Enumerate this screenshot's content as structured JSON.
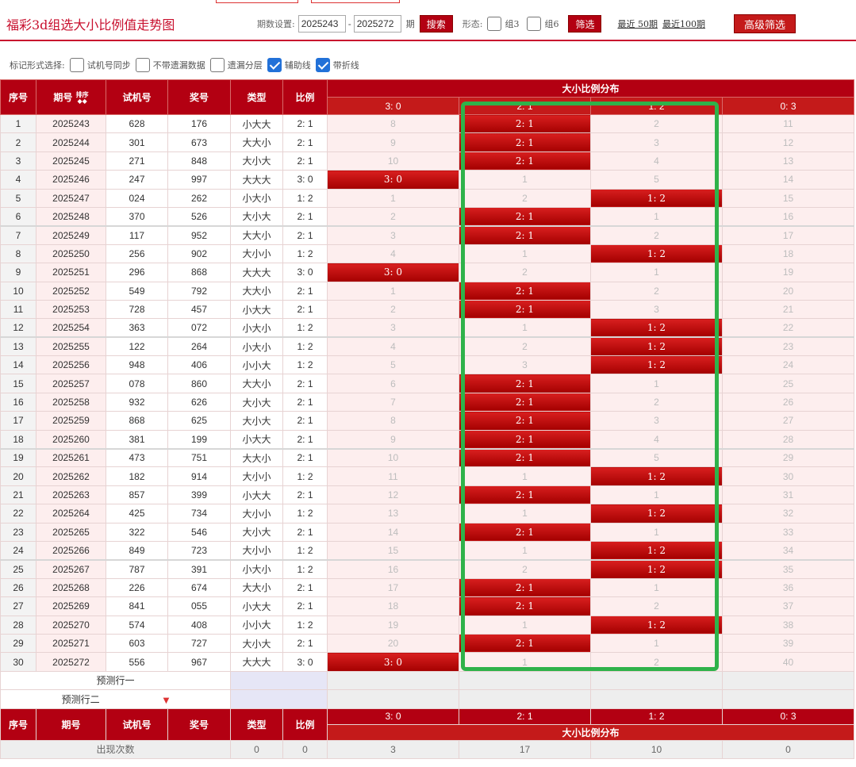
{
  "header": {
    "title": "福彩3d组选大小比例值走势图",
    "issue_label": "期数设置:",
    "issue_from": "2025243",
    "issue_to": "2025272",
    "issue_suffix": "期",
    "search_button": "搜索",
    "form_label": "形态:",
    "group3_label": "组3",
    "group6_label": "组6",
    "filter_button": "筛选",
    "recent50": "最近 50期",
    "recent100": "最近100期",
    "advanced_button": "高级筛选"
  },
  "markbar": {
    "label": "标记形式选择:",
    "opt1": "试机号同步",
    "opt2": "不带遗漏数据",
    "opt3": "遗漏分层",
    "opt4": "辅助线",
    "opt5": "带折线",
    "opt4_checked": true,
    "opt5_checked": true
  },
  "table": {
    "headers": {
      "seq": "序号",
      "issue": "期号",
      "sort": "排序",
      "trial": "试机号",
      "prize": "奖号",
      "type": "类型",
      "ratio": "比例",
      "distribution": "大小比例分布"
    },
    "dist_columns": [
      "3: 0",
      "2: 1",
      "1: 2",
      "0: 3"
    ],
    "rows": [
      {
        "seq": "1",
        "issue": "2025243",
        "trial": "628",
        "prize": "176",
        "type": "小大大",
        "ratio": "2: 1",
        "dist": [
          "8",
          "2: 1",
          "2",
          "11"
        ],
        "hit": 1
      },
      {
        "seq": "2",
        "issue": "2025244",
        "trial": "301",
        "prize": "673",
        "type": "大大小",
        "ratio": "2: 1",
        "dist": [
          "9",
          "2: 1",
          "3",
          "12"
        ],
        "hit": 1
      },
      {
        "seq": "3",
        "issue": "2025245",
        "trial": "271",
        "prize": "848",
        "type": "大小大",
        "ratio": "2: 1",
        "dist": [
          "10",
          "2: 1",
          "4",
          "13"
        ],
        "hit": 1
      },
      {
        "seq": "4",
        "issue": "2025246",
        "trial": "247",
        "prize": "997",
        "type": "大大大",
        "ratio": "3: 0",
        "dist": [
          "3: 0",
          "1",
          "5",
          "14"
        ],
        "hit": 0
      },
      {
        "seq": "5",
        "issue": "2025247",
        "trial": "024",
        "prize": "262",
        "type": "小大小",
        "ratio": "1: 2",
        "dist": [
          "1",
          "2",
          "1: 2",
          "15"
        ],
        "hit": 2
      },
      {
        "seq": "6",
        "issue": "2025248",
        "trial": "370",
        "prize": "526",
        "type": "大小大",
        "ratio": "2: 1",
        "dist": [
          "2",
          "2: 1",
          "1",
          "16"
        ],
        "hit": 1
      },
      {
        "seq": "7",
        "issue": "2025249",
        "trial": "117",
        "prize": "952",
        "type": "大大小",
        "ratio": "2: 1",
        "dist": [
          "3",
          "2: 1",
          "2",
          "17"
        ],
        "hit": 1
      },
      {
        "seq": "8",
        "issue": "2025250",
        "trial": "256",
        "prize": "902",
        "type": "大小小",
        "ratio": "1: 2",
        "dist": [
          "4",
          "1",
          "1: 2",
          "18"
        ],
        "hit": 2
      },
      {
        "seq": "9",
        "issue": "2025251",
        "trial": "296",
        "prize": "868",
        "type": "大大大",
        "ratio": "3: 0",
        "dist": [
          "3: 0",
          "2",
          "1",
          "19"
        ],
        "hit": 0
      },
      {
        "seq": "10",
        "issue": "2025252",
        "trial": "549",
        "prize": "792",
        "type": "大大小",
        "ratio": "2: 1",
        "dist": [
          "1",
          "2: 1",
          "2",
          "20"
        ],
        "hit": 1
      },
      {
        "seq": "11",
        "issue": "2025253",
        "trial": "728",
        "prize": "457",
        "type": "小大大",
        "ratio": "2: 1",
        "dist": [
          "2",
          "2: 1",
          "3",
          "21"
        ],
        "hit": 1
      },
      {
        "seq": "12",
        "issue": "2025254",
        "trial": "363",
        "prize": "072",
        "type": "小大小",
        "ratio": "1: 2",
        "dist": [
          "3",
          "1",
          "1: 2",
          "22"
        ],
        "hit": 2
      },
      {
        "seq": "13",
        "issue": "2025255",
        "trial": "122",
        "prize": "264",
        "type": "小大小",
        "ratio": "1: 2",
        "dist": [
          "4",
          "2",
          "1: 2",
          "23"
        ],
        "hit": 2
      },
      {
        "seq": "14",
        "issue": "2025256",
        "trial": "948",
        "prize": "406",
        "type": "小小大",
        "ratio": "1: 2",
        "dist": [
          "5",
          "3",
          "1: 2",
          "24"
        ],
        "hit": 2
      },
      {
        "seq": "15",
        "issue": "2025257",
        "trial": "078",
        "prize": "860",
        "type": "大大小",
        "ratio": "2: 1",
        "dist": [
          "6",
          "2: 1",
          "1",
          "25"
        ],
        "hit": 1
      },
      {
        "seq": "16",
        "issue": "2025258",
        "trial": "932",
        "prize": "626",
        "type": "大小大",
        "ratio": "2: 1",
        "dist": [
          "7",
          "2: 1",
          "2",
          "26"
        ],
        "hit": 1
      },
      {
        "seq": "17",
        "issue": "2025259",
        "trial": "868",
        "prize": "625",
        "type": "大小大",
        "ratio": "2: 1",
        "dist": [
          "8",
          "2: 1",
          "3",
          "27"
        ],
        "hit": 1
      },
      {
        "seq": "18",
        "issue": "2025260",
        "trial": "381",
        "prize": "199",
        "type": "小大大",
        "ratio": "2: 1",
        "dist": [
          "9",
          "2: 1",
          "4",
          "28"
        ],
        "hit": 1
      },
      {
        "seq": "19",
        "issue": "2025261",
        "trial": "473",
        "prize": "751",
        "type": "大大小",
        "ratio": "2: 1",
        "dist": [
          "10",
          "2: 1",
          "5",
          "29"
        ],
        "hit": 1
      },
      {
        "seq": "20",
        "issue": "2025262",
        "trial": "182",
        "prize": "914",
        "type": "大小小",
        "ratio": "1: 2",
        "dist": [
          "11",
          "1",
          "1: 2",
          "30"
        ],
        "hit": 2
      },
      {
        "seq": "21",
        "issue": "2025263",
        "trial": "857",
        "prize": "399",
        "type": "小大大",
        "ratio": "2: 1",
        "dist": [
          "12",
          "2: 1",
          "1",
          "31"
        ],
        "hit": 1
      },
      {
        "seq": "22",
        "issue": "2025264",
        "trial": "425",
        "prize": "734",
        "type": "大小小",
        "ratio": "1: 2",
        "dist": [
          "13",
          "1",
          "1: 2",
          "32"
        ],
        "hit": 2
      },
      {
        "seq": "23",
        "issue": "2025265",
        "trial": "322",
        "prize": "546",
        "type": "大小大",
        "ratio": "2: 1",
        "dist": [
          "14",
          "2: 1",
          "1",
          "33"
        ],
        "hit": 1
      },
      {
        "seq": "24",
        "issue": "2025266",
        "trial": "849",
        "prize": "723",
        "type": "大小小",
        "ratio": "1: 2",
        "dist": [
          "15",
          "1",
          "1: 2",
          "34"
        ],
        "hit": 2
      },
      {
        "seq": "25",
        "issue": "2025267",
        "trial": "787",
        "prize": "391",
        "type": "小大小",
        "ratio": "1: 2",
        "dist": [
          "16",
          "2",
          "1: 2",
          "35"
        ],
        "hit": 2
      },
      {
        "seq": "26",
        "issue": "2025268",
        "trial": "226",
        "prize": "674",
        "type": "大大小",
        "ratio": "2: 1",
        "dist": [
          "17",
          "2: 1",
          "1",
          "36"
        ],
        "hit": 1
      },
      {
        "seq": "27",
        "issue": "2025269",
        "trial": "841",
        "prize": "055",
        "type": "小大大",
        "ratio": "2: 1",
        "dist": [
          "18",
          "2: 1",
          "2",
          "37"
        ],
        "hit": 1
      },
      {
        "seq": "28",
        "issue": "2025270",
        "trial": "574",
        "prize": "408",
        "type": "小小大",
        "ratio": "1: 2",
        "dist": [
          "19",
          "1",
          "1: 2",
          "38"
        ],
        "hit": 2
      },
      {
        "seq": "29",
        "issue": "2025271",
        "trial": "603",
        "prize": "727",
        "type": "大小大",
        "ratio": "2: 1",
        "dist": [
          "20",
          "2: 1",
          "1",
          "39"
        ],
        "hit": 1
      },
      {
        "seq": "30",
        "issue": "2025272",
        "trial": "556",
        "prize": "967",
        "type": "大大大",
        "ratio": "3: 0",
        "dist": [
          "3: 0",
          "1",
          "2",
          "40"
        ],
        "hit": 0
      }
    ],
    "predict1": "预测行一",
    "predict2": "预测行二",
    "count_label": "出现次数",
    "count_type": "0",
    "count_ratio": "0",
    "counts": [
      "3",
      "17",
      "10",
      "0"
    ]
  },
  "colors": {
    "brand_red": "#b30012",
    "highlight_green": "#2fb24a",
    "checkbox_blue": "#2271d8"
  }
}
